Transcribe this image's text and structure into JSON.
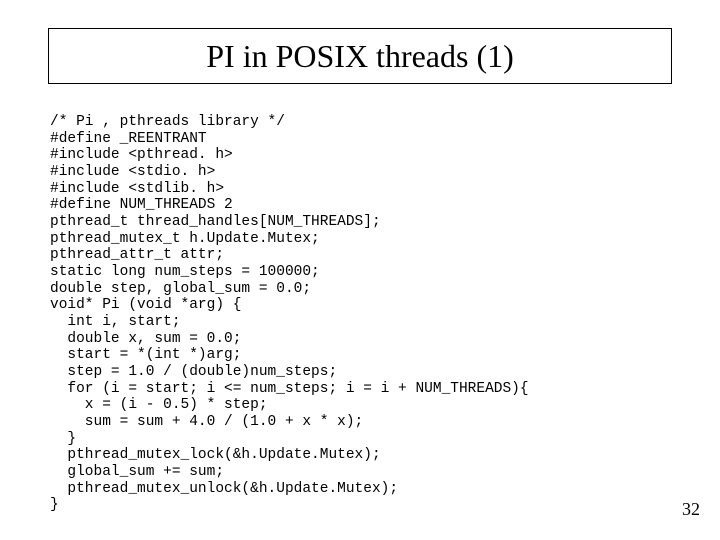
{
  "title": "PI in POSIX threads (1)",
  "page_number": "32",
  "code": "/* Pi , pthreads library */\n#define _REENTRANT\n#include <pthread. h>\n#include <stdio. h>\n#include <stdlib. h>\n#define NUM_THREADS 2\npthread_t thread_handles[NUM_THREADS];\npthread_mutex_t h.Update.Mutex;\npthread_attr_t attr;\nstatic long num_steps = 100000;\ndouble step, global_sum = 0.0;\nvoid* Pi (void *arg) {\n  int i, start;\n  double x, sum = 0.0;\n  start = *(int *)arg;\n  step = 1.0 / (double)num_steps;\n  for (i = start; i <= num_steps; i = i + NUM_THREADS){\n    x = (i - 0.5) * step;\n    sum = sum + 4.0 / (1.0 + x * x);\n  }\n  pthread_mutex_lock(&h.Update.Mutex);\n  global_sum += sum;\n  pthread_mutex_unlock(&h.Update.Mutex);\n}"
}
